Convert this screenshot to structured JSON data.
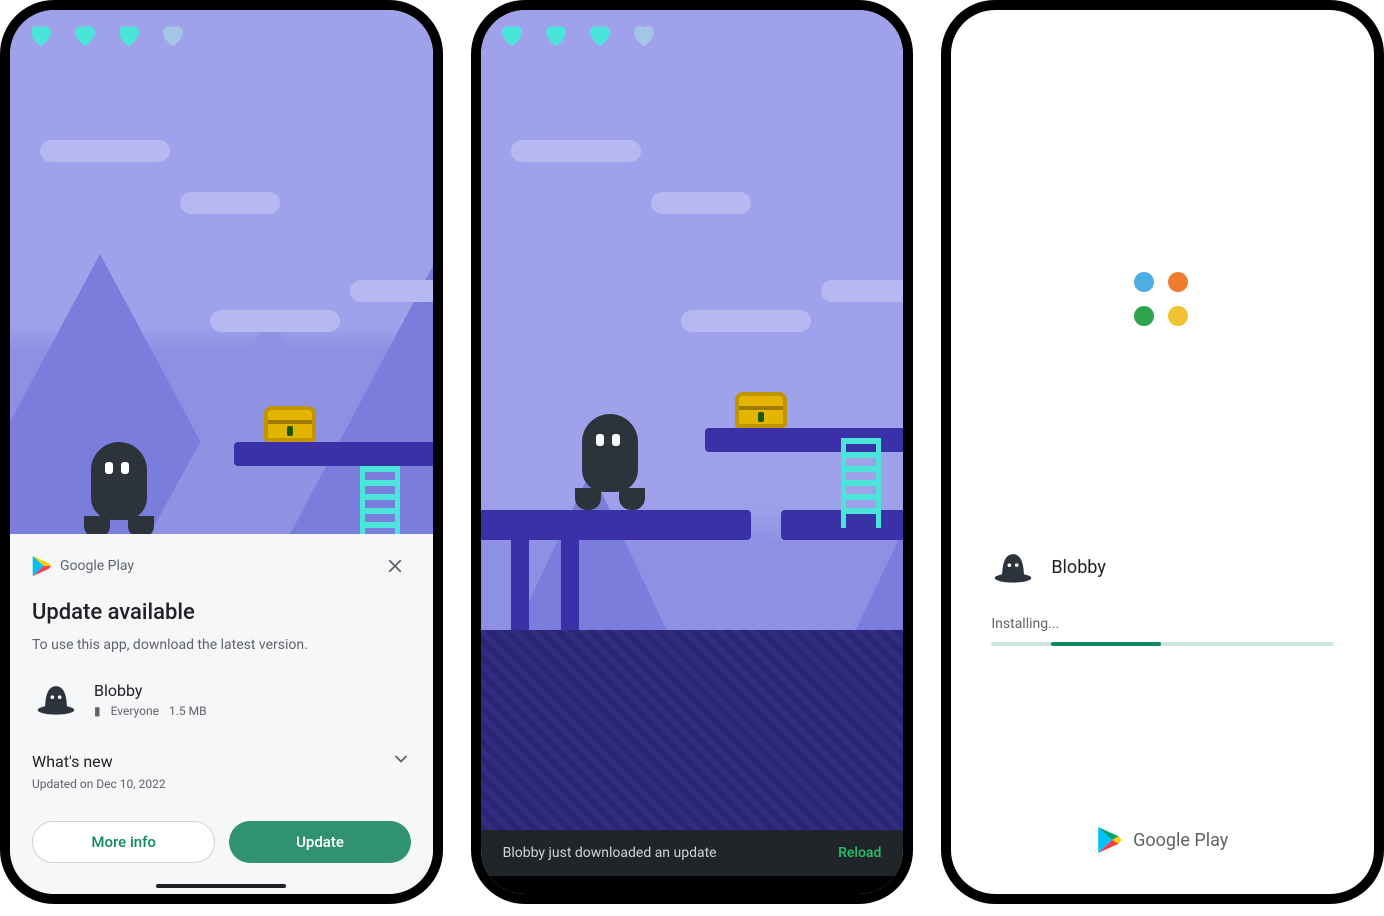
{
  "branding": {
    "play_label": "Google Play"
  },
  "screen1": {
    "sheet": {
      "title": "Update available",
      "subtitle": "To use this app, download the latest version.",
      "app": {
        "name": "Blobby",
        "rating_label": "Everyone",
        "size": "1.5 MB"
      },
      "whats_new": {
        "title": "What's new",
        "updated": "Updated on Dec 10, 2022"
      },
      "buttons": {
        "more_info": "More info",
        "update": "Update"
      }
    }
  },
  "screen2": {
    "snackbar": {
      "message": "Blobby just downloaded an update",
      "action": "Reload"
    }
  },
  "screen3": {
    "app_name": "Blobby",
    "status": "Installing..."
  }
}
